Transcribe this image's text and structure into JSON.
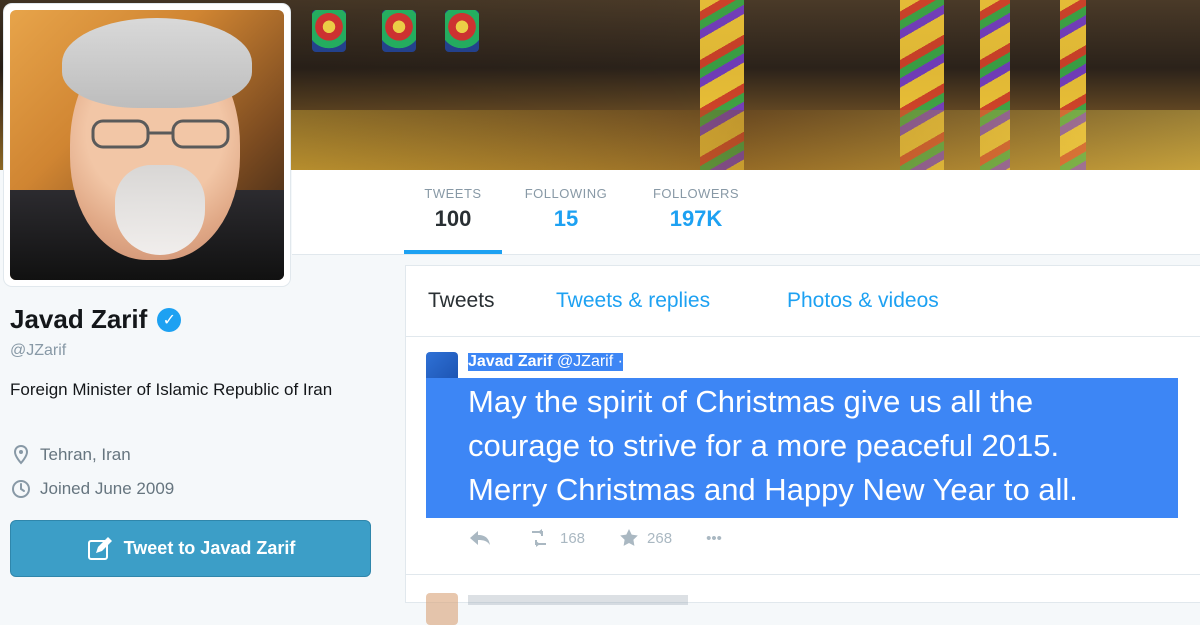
{
  "profile": {
    "name": "Javad Zarif",
    "handle": "@JZarif",
    "bio": "Foreign Minister of Islamic Republic of Iran",
    "location": "Tehran, Iran",
    "joined": "Joined June 2009",
    "tweet_to_button": "Tweet to Javad Zarif"
  },
  "stats": [
    {
      "label": "TWEETS",
      "value": "100"
    },
    {
      "label": "FOLLOWING",
      "value": "15"
    },
    {
      "label": "FOLLOWERS",
      "value": "197K"
    }
  ],
  "timeline": {
    "tabs": [
      "Tweets",
      "Tweets & replies",
      "Photos & videos"
    ],
    "tweet": {
      "author": "Javad Zarif",
      "handle": "@JZarif",
      "separator": "·",
      "text_lines": [
        "May the spirit of Christmas give us all the",
        "courage to strive for a more peaceful 2015.",
        "Merry Christmas and Happy New Year to all."
      ],
      "retweets": "168",
      "favorites": "268",
      "more": "•••"
    }
  },
  "colors": {
    "accent": "#1da1f2",
    "selection": "#3d86f5",
    "button": "#3c9ec7"
  }
}
